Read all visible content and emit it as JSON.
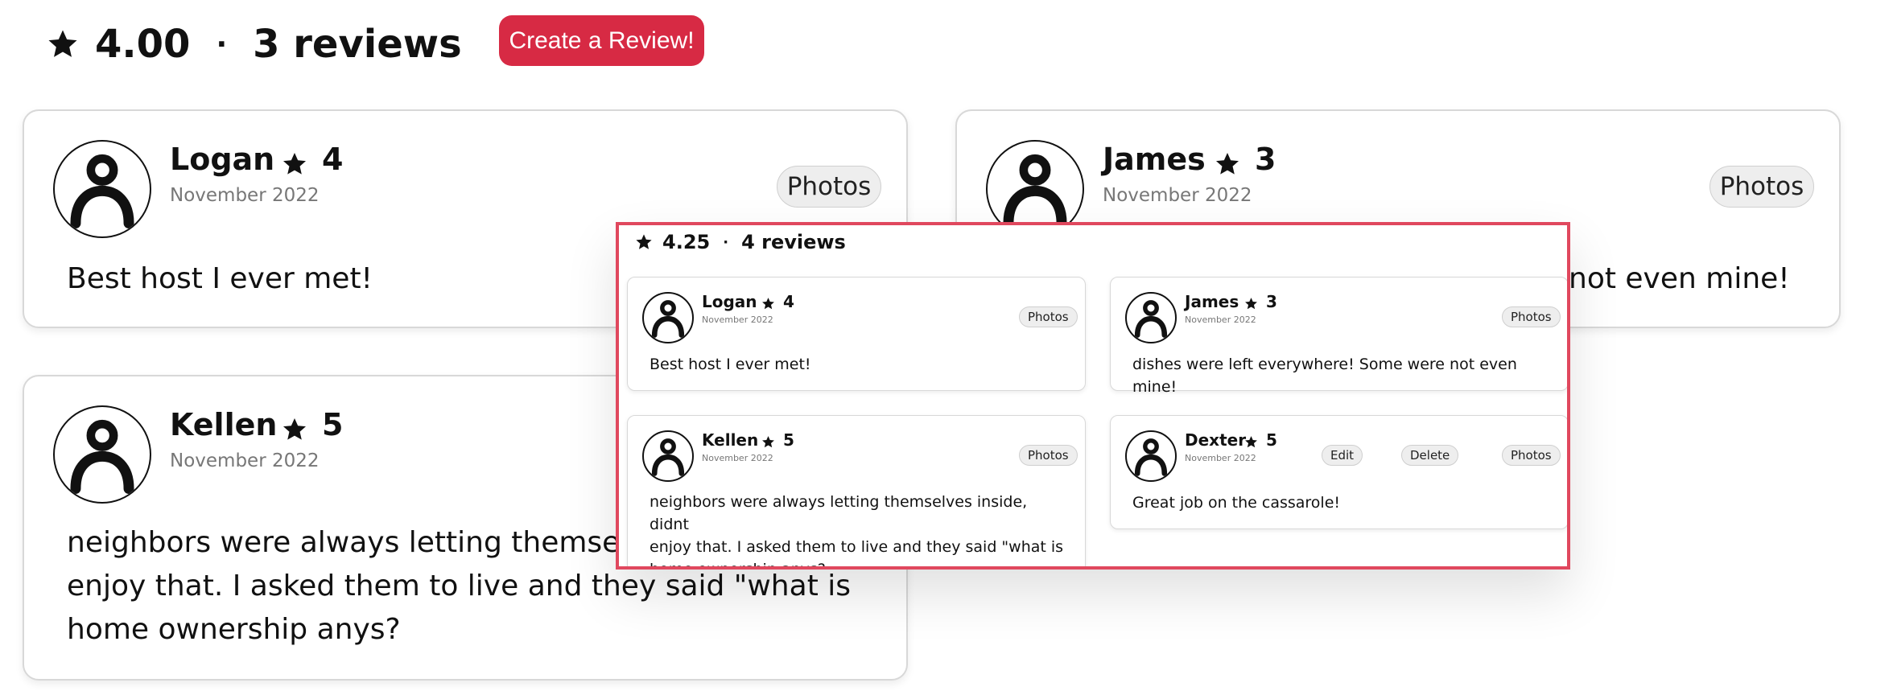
{
  "header": {
    "rating": "4.00",
    "separator": "·",
    "count": "3 reviews",
    "create_label": "Create a Review!"
  },
  "reviews": [
    {
      "name": "Logan",
      "rating": "4",
      "date": "November 2022",
      "photos_label": "Photos",
      "text": "Best host I ever met!"
    },
    {
      "name": "James",
      "rating": "3",
      "date": "November 2022",
      "photos_label": "Photos",
      "text": "not even mine!"
    },
    {
      "name": "Kellen",
      "rating": "5",
      "date": "November 2022",
      "photos_label": "Photos",
      "lines": [
        "neighbors were always letting themselv",
        "enjoy that. I asked them to live and they said \"what is",
        "home ownership anys?"
      ]
    }
  ],
  "modal": {
    "rating": "4.25",
    "separator": "·",
    "count": "4 reviews",
    "reviews": [
      {
        "name": "Logan",
        "rating": "4",
        "date": "November 2022",
        "photos_label": "Photos",
        "text": "Best host I ever met!"
      },
      {
        "name": "James",
        "rating": "3",
        "date": "November 2022",
        "photos_label": "Photos",
        "text": "dishes were left everywhere! Some were not even mine!"
      },
      {
        "name": "Kellen",
        "rating": "5",
        "date": "November 2022",
        "photos_label": "Photos",
        "lines": [
          "neighbors were always letting themselves inside, didnt",
          "enjoy that. I asked them to live and they said \"what is",
          "home ownership anys?"
        ]
      },
      {
        "name": "Dexter",
        "rating": "5",
        "date": "November 2022",
        "edit_label": "Edit",
        "delete_label": "Delete",
        "photos_label": "Photos",
        "text": "Great job on the cassarole!"
      }
    ]
  },
  "colors": {
    "accent": "#d72a44",
    "modal_border": "#e0485e"
  },
  "icons": {
    "star": "star-icon",
    "avatar": "user-avatar-icon"
  }
}
